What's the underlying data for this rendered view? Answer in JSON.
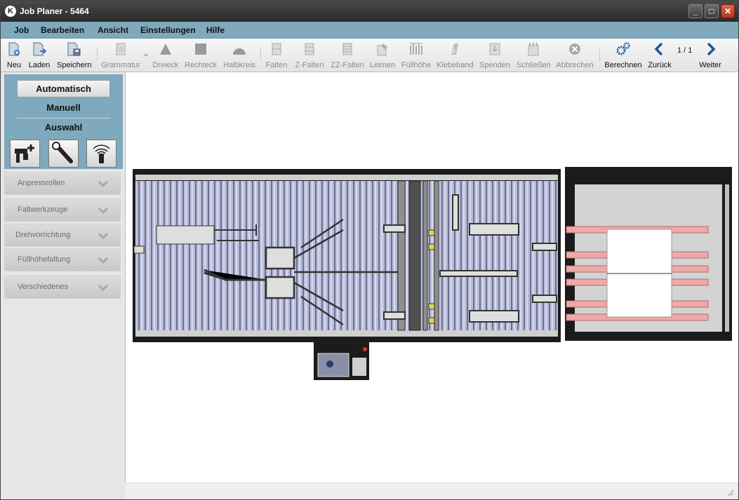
{
  "window": {
    "title": "Job Planer - 5464",
    "app_icon": "K"
  },
  "menu": [
    "Job",
    "Bearbeiten",
    "Ansicht",
    "Einstellungen",
    "Hilfe"
  ],
  "toolbar": {
    "items": [
      {
        "label": "Neu",
        "icon": "new-document-icon",
        "enabled": true
      },
      {
        "label": "Laden",
        "icon": "load-icon",
        "enabled": true
      },
      {
        "label": "Speichern",
        "icon": "save-icon",
        "enabled": true
      },
      {
        "label": "Grammatur",
        "icon": "grammage-icon",
        "enabled": false
      },
      {
        "label": "Dreieck",
        "icon": "triangle-icon",
        "enabled": false
      },
      {
        "label": "Rechteck",
        "icon": "rectangle-icon",
        "enabled": false
      },
      {
        "label": "Halbkreis",
        "icon": "semicircle-icon",
        "enabled": false
      },
      {
        "label": "Falten",
        "icon": "fold-icon",
        "enabled": false
      },
      {
        "label": "Z-Falten",
        "icon": "z-fold-icon",
        "enabled": false
      },
      {
        "label": "ZZ-Falten",
        "icon": "zz-fold-icon",
        "enabled": false
      },
      {
        "label": "Leimen",
        "icon": "glue-icon",
        "enabled": false
      },
      {
        "label": "Füllhöhe",
        "icon": "fill-height-icon",
        "enabled": false
      },
      {
        "label": "Klebeband",
        "icon": "tape-icon",
        "enabled": false
      },
      {
        "label": "Spenden",
        "icon": "dispense-icon",
        "enabled": false
      },
      {
        "label": "Schließen",
        "icon": "close-box-icon",
        "enabled": false
      },
      {
        "label": "Abbrechen",
        "icon": "cancel-icon",
        "enabled": false
      },
      {
        "label": "Berechnen",
        "icon": "gears-icon",
        "enabled": true
      },
      {
        "label": "Zurück",
        "icon": "chevron-left-icon",
        "enabled": true
      },
      {
        "label": "Weiter",
        "icon": "chevron-right-icon",
        "enabled": true
      }
    ],
    "pager": "1 / 1"
  },
  "sidebar": {
    "modes": {
      "auto": "Automatisch",
      "manual": "Manuell",
      "selection": "Auswahl"
    },
    "tool_icons": [
      "machine-add-icon",
      "wrench-icon",
      "wireless-icon"
    ],
    "accordion": [
      "Anpressrollen",
      "Faltwerkzeuge",
      "Drehvorrichtung",
      "Füllhöhefaltung",
      "Verschiedenes"
    ]
  },
  "colors": {
    "menu_bg": "#7fa9bc",
    "roller_blue": "#b9bcd9",
    "belt_pink": "#f0a8a8"
  }
}
